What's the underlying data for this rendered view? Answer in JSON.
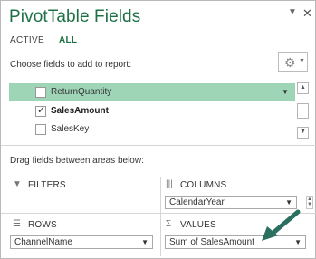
{
  "header": {
    "title": "PivotTable Fields",
    "dropdown_glyph": "▼",
    "close_glyph": "✕"
  },
  "tabs": [
    {
      "label": "ACTIVE"
    },
    {
      "label": "ALL"
    }
  ],
  "choose_label": "Choose fields to add to report:",
  "fields": [
    {
      "label": "ReturnQuantity",
      "checked": false,
      "selected": true
    },
    {
      "label": "SalesAmount",
      "checked": true,
      "selected": false
    },
    {
      "label": "SalesKey",
      "checked": false,
      "selected": false
    }
  ],
  "drag_label": "Drag fields between areas below:",
  "areas": {
    "filters": {
      "label": "FILTERS"
    },
    "columns": {
      "label": "COLUMNS",
      "items": [
        "CalendarYear"
      ]
    },
    "rows": {
      "label": "ROWS",
      "items": [
        "ChannelName"
      ]
    },
    "values": {
      "label": "VALUES",
      "items": [
        "Sum of SalesAmount"
      ]
    }
  },
  "colors": {
    "accent": "#1e7145",
    "selected_row": "#9fd5b7",
    "arrow": "#2a6f5f"
  }
}
